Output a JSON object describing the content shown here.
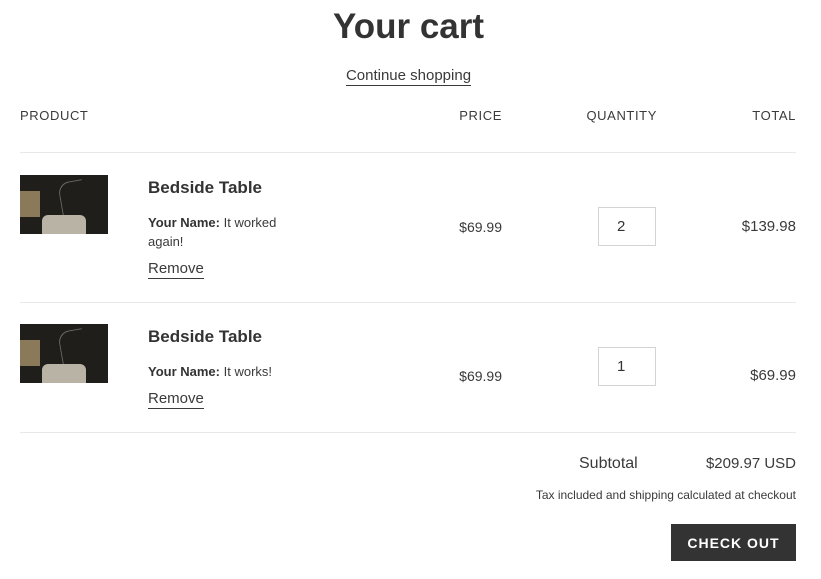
{
  "page": {
    "title": "Your cart",
    "continue_label": "Continue shopping"
  },
  "table": {
    "headers": {
      "product": "PRODUCT",
      "price": "PRICE",
      "quantity": "QUANTITY",
      "total": "TOTAL"
    },
    "items": [
      {
        "name": "Bedside Table",
        "property_label": "Your Name:",
        "property_value": "It worked again!",
        "remove_label": "Remove",
        "price": "$69.99",
        "quantity": "2",
        "total": "$139.98"
      },
      {
        "name": "Bedside Table",
        "property_label": "Your Name:",
        "property_value": "It works!",
        "remove_label": "Remove",
        "price": "$69.99",
        "quantity": "1",
        "total": "$69.99"
      }
    ]
  },
  "summary": {
    "subtotal_label": "Subtotal",
    "subtotal_value": "$209.97 USD",
    "tax_note": "Tax included and shipping calculated at checkout",
    "checkout_label": "CHECK OUT"
  },
  "colors": {
    "text": "#3a3a3a",
    "heading": "#333333",
    "button_bg": "#333333",
    "button_text": "#ffffff",
    "divider": "#e8e8e8"
  }
}
